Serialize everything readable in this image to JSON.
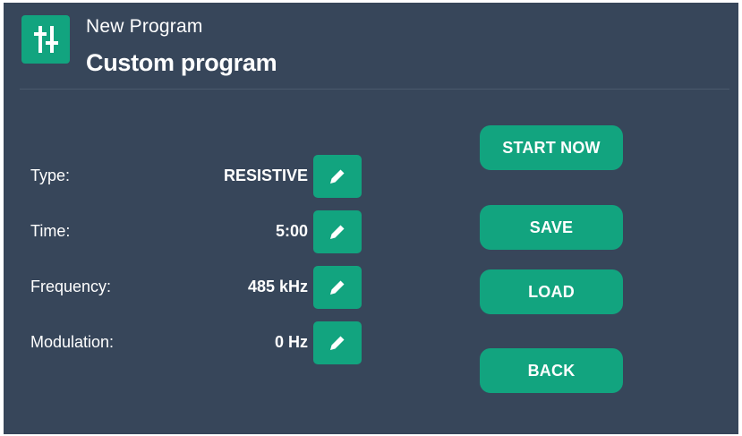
{
  "header": {
    "icon": "sliders-icon",
    "subtitle": "New Program",
    "title": "Custom program"
  },
  "settings": [
    {
      "label": "Type:",
      "value": "RESISTIVE",
      "icon": "pencil-icon"
    },
    {
      "label": "Time:",
      "value": "5:00",
      "icon": "pencil-icon"
    },
    {
      "label": "Frequency:",
      "value": "485 kHz",
      "icon": "pencil-icon"
    },
    {
      "label": "Modulation:",
      "value": "0 Hz",
      "icon": "pencil-icon"
    }
  ],
  "actions": {
    "start_now": "START NOW",
    "save": "SAVE",
    "load": "LOAD",
    "back": "BACK"
  },
  "colors": {
    "background": "#37465a",
    "accent": "#12a47f",
    "text": "#ffffff"
  }
}
